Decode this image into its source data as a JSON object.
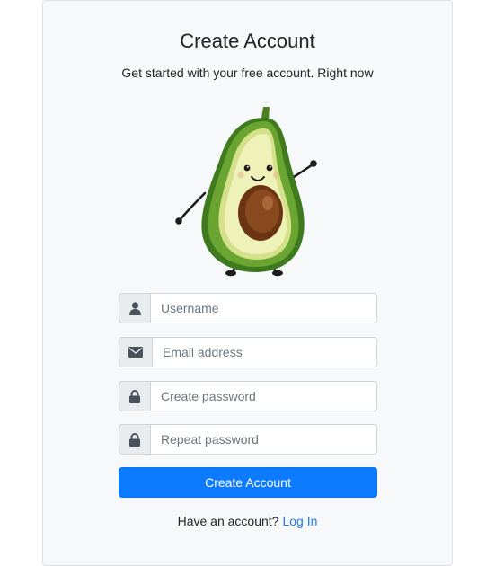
{
  "header": {
    "title": "Create Account",
    "subtitle": "Get started with your free account. Right now"
  },
  "form": {
    "username": {
      "placeholder": "Username",
      "value": "",
      "icon": "user-icon"
    },
    "email": {
      "placeholder": "Email address",
      "value": "",
      "icon": "envelope-icon"
    },
    "password": {
      "placeholder": "Create password",
      "value": "",
      "icon": "lock-icon"
    },
    "repeat_password": {
      "placeholder": "Repeat password",
      "value": "",
      "icon": "lock-icon"
    },
    "submit_label": "Create Account"
  },
  "footer": {
    "prompt": "Have an account?",
    "login_label": "Log In"
  },
  "colors": {
    "accent": "#0d7bff",
    "link": "#1a7bf2",
    "card_background": "#f7f8fa",
    "addon_background": "#e9ecef"
  }
}
